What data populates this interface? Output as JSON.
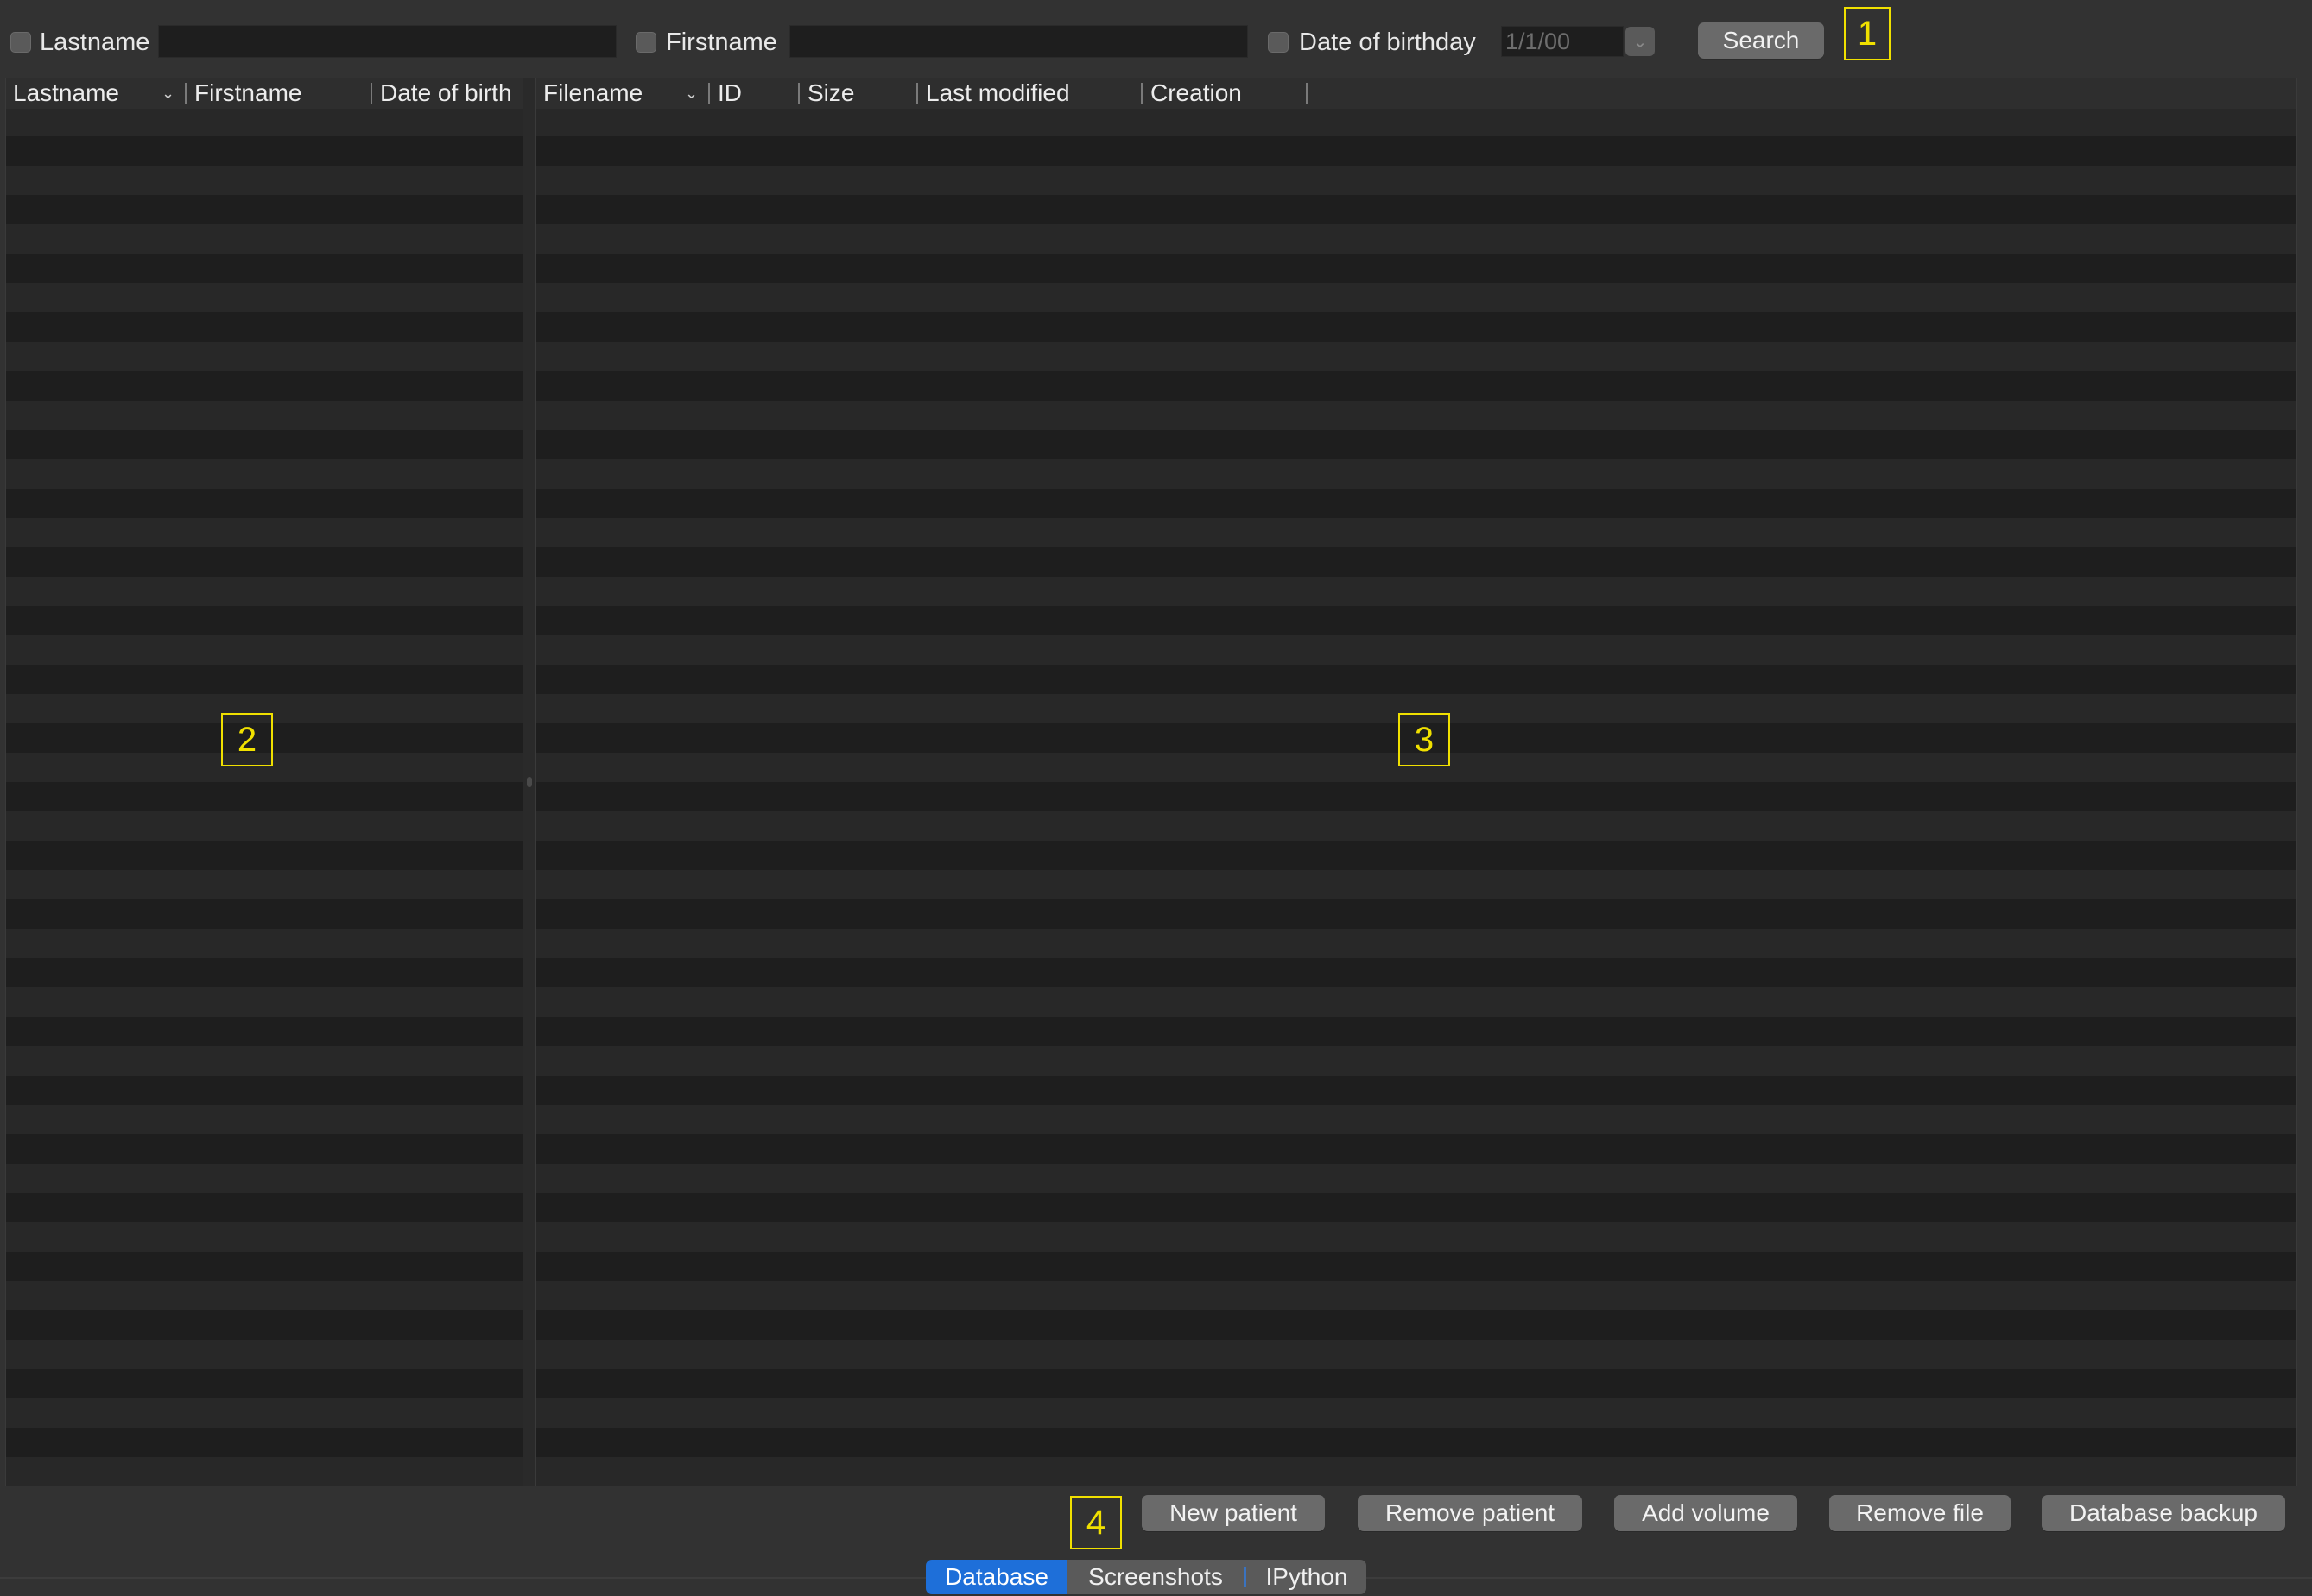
{
  "search": {
    "lastname_label": "Lastname",
    "lastname_value": "",
    "firstname_label": "Firstname",
    "firstname_value": "",
    "dob_label": "Date of birthday",
    "dob_value": "1/1/00",
    "search_button": "Search"
  },
  "patients_table": {
    "columns": [
      "Lastname",
      "Firstname",
      "Date of birth"
    ],
    "rows": []
  },
  "files_table": {
    "columns": [
      "Filename",
      "ID",
      "Size",
      "Last modified",
      "Creation"
    ],
    "rows": []
  },
  "actions": {
    "new_patient": "New patient",
    "remove_patient": "Remove patient",
    "add_volume": "Add volume",
    "remove_file": "Remove file",
    "database_backup": "Database backup"
  },
  "tabs": [
    "Database",
    "Screenshots",
    "IPython"
  ],
  "active_tab": "Database",
  "markers": [
    "1",
    "2",
    "3",
    "4"
  ],
  "colors": {
    "accent": "#1e6fd9",
    "marker": "#f0e000",
    "background": "#323232"
  }
}
